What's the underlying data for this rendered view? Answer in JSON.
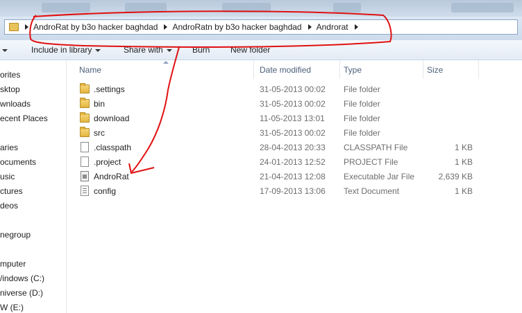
{
  "breadcrumb": {
    "items": [
      "AndroRat  by b3o hacker baghdad",
      "AndroRatn  by b3o hacker baghdad",
      "Androrat"
    ]
  },
  "toolbar": {
    "include_label": "Include in library",
    "share_label": "Share with",
    "burn_label": "Burn",
    "new_folder_label": "New folder"
  },
  "nav": {
    "favorites": "orites",
    "desktop": "sktop",
    "downloads": "wnloads",
    "recent": "ecent Places",
    "libraries": "aries",
    "documents": "ocuments",
    "music": "usic",
    "pictures": "ctures",
    "videos": "deos",
    "homegroup": "negroup",
    "computer": "mputer",
    "windows": "/indows (C:)",
    "universe": "niverse (D:)",
    "new": "W (E:)"
  },
  "columns": {
    "name": "Name",
    "date": "Date modified",
    "type": "Type",
    "size": "Size"
  },
  "files": [
    {
      "name": ".settings",
      "date": "31-05-2013 00:02",
      "type": "File folder",
      "size": "",
      "icon": "folder-icon"
    },
    {
      "name": "bin",
      "date": "31-05-2013 00:02",
      "type": "File folder",
      "size": "",
      "icon": "folder-icon"
    },
    {
      "name": "download",
      "date": "11-05-2013 13:01",
      "type": "File folder",
      "size": "",
      "icon": "folder-icon"
    },
    {
      "name": "src",
      "date": "31-05-2013 00:02",
      "type": "File folder",
      "size": "",
      "icon": "folder-icon"
    },
    {
      "name": ".classpath",
      "date": "28-04-2013 20:33",
      "type": "CLASSPATH File",
      "size": "1 KB",
      "icon": "file-icon"
    },
    {
      "name": ".project",
      "date": "24-01-2013 12:52",
      "type": "PROJECT File",
      "size": "1 KB",
      "icon": "file-icon"
    },
    {
      "name": "AndroRat",
      "date": "21-04-2013 12:08",
      "type": "Executable Jar File",
      "size": "2,639 KB",
      "icon": "jar-icon"
    },
    {
      "name": "config",
      "date": "17-09-2013 13:06",
      "type": "Text Document",
      "size": "1 KB",
      "icon": "text-document-icon"
    }
  ],
  "colors": {
    "annotation": "#e01010",
    "header_text": "#4c607a",
    "detail_text": "#6d6d6d"
  }
}
